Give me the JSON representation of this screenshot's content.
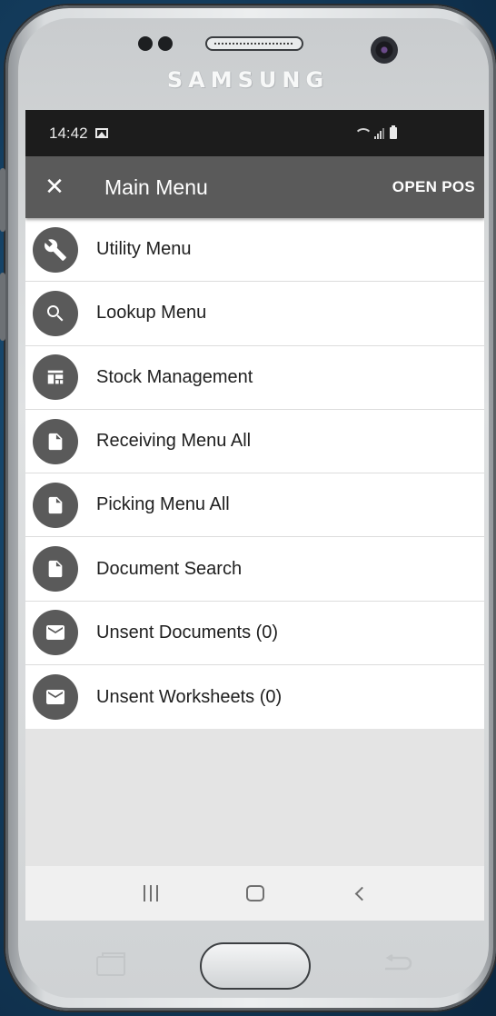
{
  "device": {
    "brand": "SAMSUNG"
  },
  "statusbar": {
    "time": "14:42",
    "icons": [
      "image-icon",
      "wifi-icon",
      "signal-icon",
      "battery-icon"
    ]
  },
  "appbar": {
    "close_icon": "close-icon",
    "title": "Main Menu",
    "action_label": "OPEN POS",
    "background": "#5a5a5a"
  },
  "menu": {
    "items": [
      {
        "label": "Utility Menu",
        "icon": "wrench-icon"
      },
      {
        "label": "Lookup Menu",
        "icon": "search-icon"
      },
      {
        "label": "Stock Management",
        "icon": "dashboard-icon"
      },
      {
        "label": "Receiving Menu All",
        "icon": "document-icon"
      },
      {
        "label": "Picking Menu All",
        "icon": "document-icon"
      },
      {
        "label": "Document Search",
        "icon": "document-icon"
      },
      {
        "label": "Unsent Documents (0)",
        "icon": "mail-icon"
      },
      {
        "label": "Unsent Worksheets (0)",
        "icon": "mail-icon"
      }
    ],
    "icon_color": "#5a5a5a"
  },
  "navbar": {
    "buttons": [
      "recents-icon",
      "home-icon",
      "back-icon"
    ]
  }
}
